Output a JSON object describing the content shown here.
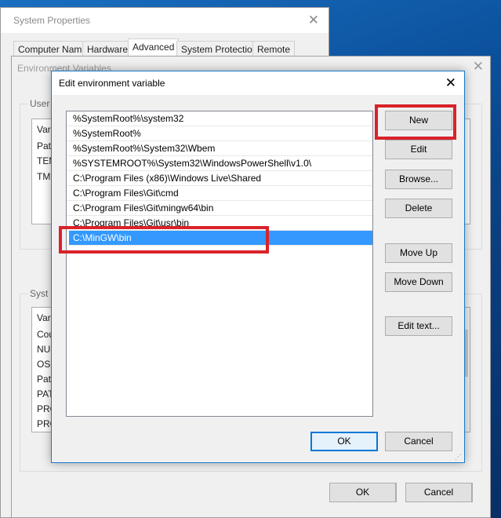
{
  "system_properties": {
    "title": "System Properties",
    "tabs": [
      "Computer Name",
      "Hardware",
      "Advanced",
      "System Protection",
      "Remote"
    ],
    "active_tab": "Advanced",
    "buttons": {
      "ok": "OK",
      "cancel": "Cancel"
    }
  },
  "env_vars": {
    "title": "Environment Variables",
    "user_group_label": "User v",
    "user_list_header": "Var",
    "user_rows": [
      "Pat",
      "TEM",
      "TM"
    ],
    "system_group_label": "Syst",
    "system_list_header": "Var",
    "system_rows": [
      "Cou",
      "NU",
      "OS",
      "Pat",
      "PAT",
      "PRO",
      "PRO"
    ]
  },
  "edit_dialog": {
    "title": "Edit environment variable",
    "paths": [
      "%SystemRoot%\\system32",
      "%SystemRoot%",
      "%SystemRoot%\\System32\\Wbem",
      "%SYSTEMROOT%\\System32\\WindowsPowerShell\\v1.0\\",
      "C:\\Program Files (x86)\\Windows Live\\Shared",
      "C:\\Program Files\\Git\\cmd",
      "C:\\Program Files\\Git\\mingw64\\bin",
      "C:\\Program Files\\Git\\usr\\bin",
      "C:\\MinGW\\bin"
    ],
    "selected_index": 8,
    "buttons": {
      "new": "New",
      "edit": "Edit",
      "browse": "Browse...",
      "delete": "Delete",
      "move_up": "Move Up",
      "move_down": "Move Down",
      "edit_text": "Edit text...",
      "ok": "OK",
      "cancel": "Cancel"
    }
  },
  "colors": {
    "highlight_box": "#d9222a",
    "selection": "#3399ff",
    "accent": "#0078d7"
  },
  "icons": {
    "close": "close-icon"
  }
}
